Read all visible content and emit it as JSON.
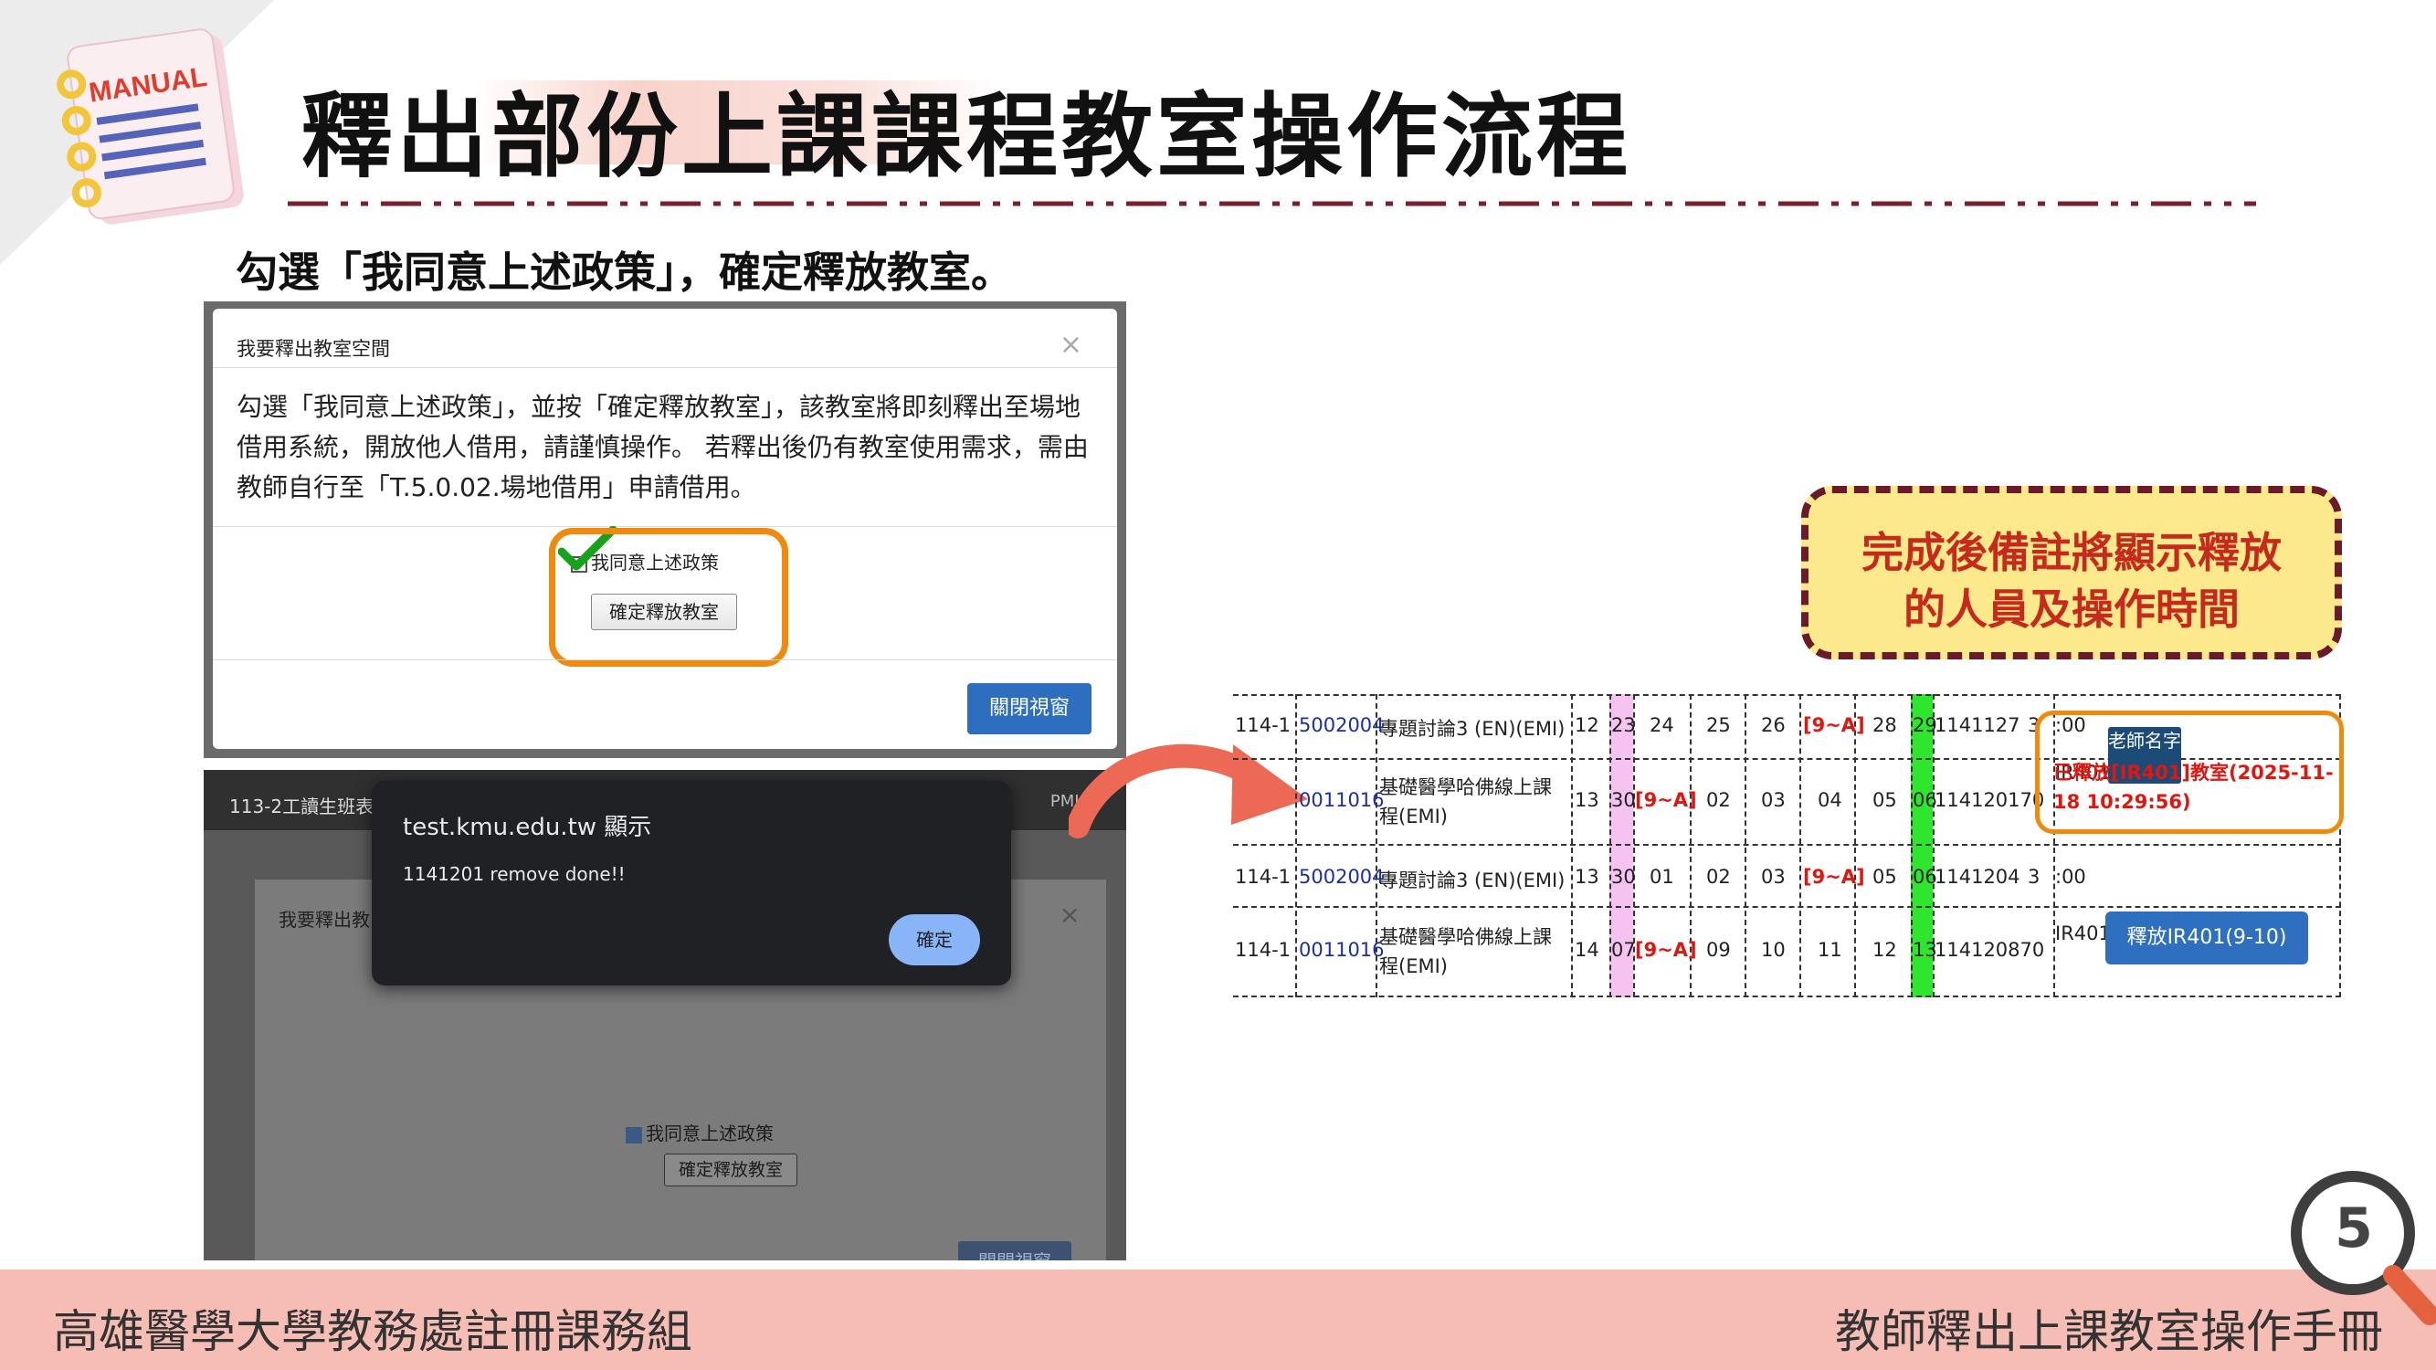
{
  "header": {
    "icon_label": "MANUAL",
    "title": "釋出部份上課課程教室操作流程",
    "subtitle": "勾選「我同意上述政策」，確定釋放教室。"
  },
  "dialog": {
    "title": "我要釋出教室空間",
    "close": "×",
    "body": "勾選「我同意上述政策」，並按「確定釋放教室」，該教室將即刻釋出至場地借用系統，開放他人借用，請謹慎操作。 若釋出後仍有教室使用需求，需由教師自行至「T.5.0.02.場地借用」申請借用。",
    "agree_label": "我同意上述政策",
    "confirm_button": "確定釋放教室",
    "close_button": "關閉視窗"
  },
  "alert_screen": {
    "tab_title": "113-2工讀生班表 -",
    "tab_right": "PMIS",
    "alert_title": "test.kmu.edu.tw 顯示",
    "alert_message": "1141201 remove done!!",
    "alert_ok": "確定",
    "dimmed_modal_title": "我要釋出教",
    "dimmed_close": "×",
    "dimmed_agree_label": "我同意上述政策",
    "dimmed_confirm": "確定釋放教室",
    "dimmed_close_button": "關閉視窗"
  },
  "callout": {
    "line1": "完成後備註將顯示釋放",
    "line2": "的人員及操作時間"
  },
  "table": {
    "rows": [
      {
        "term": "114-1",
        "code": "5002004",
        "course": "專題討論3 (EN)(EMI)",
        "n": "12",
        "c1": "23",
        "c2": "24",
        "c3": "25",
        "c4": "26",
        "c5": "[9~A]",
        "c6": "28",
        "c7": "29",
        "id": "1141127",
        "tail": "3",
        "note": ":00"
      },
      {
        "term": "",
        "code": "0011016",
        "course": "基礎醫學哈佛線上課程(EMI)",
        "n": "13",
        "c1": "30",
        "c2": "[9~A]",
        "c3": "02",
        "c4": "03",
        "c5": "04",
        "c6": "05",
        "c7": "06",
        "id": "114120170",
        "tail": "",
        "note": "IR401"
      },
      {
        "term": "114-1",
        "code": "5002004",
        "course": "專題討論3 (EN)(EMI)",
        "n": "13",
        "c1": "30",
        "c2": "01",
        "c3": "02",
        "c4": "03",
        "c5": "[9~A]",
        "c6": "05",
        "c7": "06",
        "id": "1141204",
        "tail": "3",
        "note": ":00"
      },
      {
        "term": "114-1",
        "code": "0011016",
        "course": "基礎醫學哈佛線上課程(EMI)",
        "n": "14",
        "c1": "07",
        "c2": "[9~A]",
        "c3": "09",
        "c4": "10",
        "c5": "11",
        "c6": "12",
        "c7": "13",
        "id": "114120870",
        "tail": "",
        "note": "IR401"
      }
    ],
    "teacher_badge": "老師名字",
    "released_note": "已釋放[IR401]教室(2025-11-18 10:29:56)",
    "release_button": "釋放IR401(9-10)"
  },
  "footer": {
    "left": "高雄醫學大學教務處註冊課務組",
    "right": "教師釋出上課教室操作手冊",
    "page_number": "5"
  },
  "colors": {
    "accent_orange": "#f08a0c",
    "title_line": "#7a1f2b",
    "footer_bg": "#f6bdb4",
    "callout_bg": "#fce98c",
    "callout_text": "#c52a1d",
    "button_blue": "#2d6fbe"
  }
}
